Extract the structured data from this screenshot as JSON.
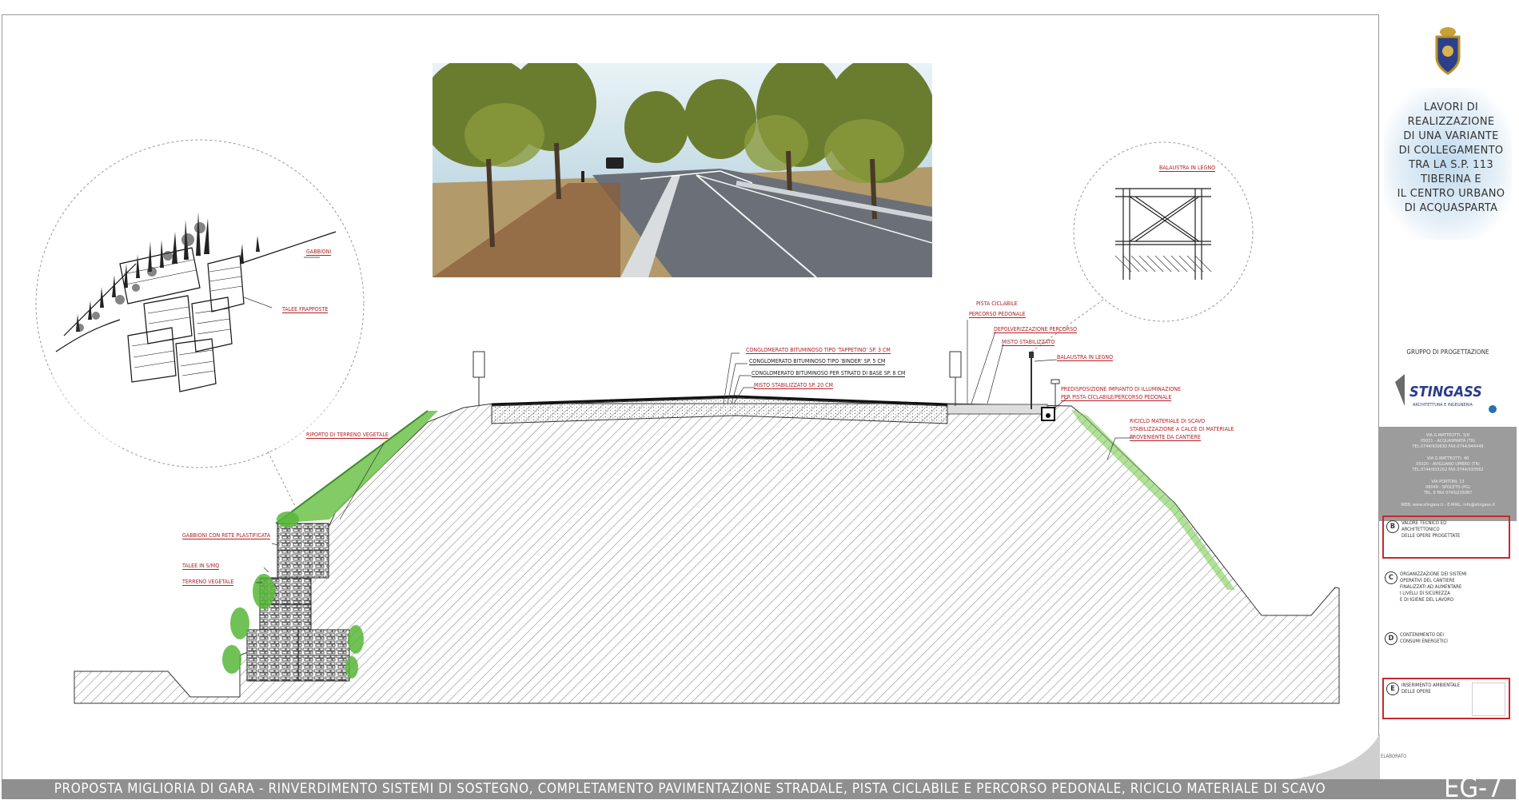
{
  "project_title": "LAVORI DI\nREALIZZAZIONE\nDI UNA VARIANTE\nDI COLLEGAMENTO\nTRA LA S.P. 113\nTIBERINA E\nIL CENTRO URBANO\nDI ACQUASPARTA",
  "gruppo_label": "GRUPPO DI PROGETTAZIONE",
  "firm": {
    "name": "STINGASS",
    "subtitle": "ARCHITETTURA E INGEGNERIA",
    "addresses": [
      "VIA G.MATTEOTTI, 3/D\n05021 - ACQUASPARTA (TR)\nTEL.0744/930630 FAX.0744/944449",
      "VIA G.MATTEOTTI, 48\n05020 - AVIGLIANO UMBRO (TR)\nTEL.0744/933202 FAX.0744/933562",
      "VIA PORTONI, 13\n06049 - SPOLETO (PG)\nTEL. E FAX 0743/235087",
      "WEB: www.stingass.it - E-MAIL: info@stingass.it"
    ]
  },
  "criteria": [
    {
      "letter": "B",
      "text": "VALORE TECNICO ED\nARCHITETTONICO\nDELLE OPERE PROGETTATE",
      "highlighted": true
    },
    {
      "letter": "C",
      "text": "ORGANIZZAZIONE DEI SISTEMI\nOPERATIVI DEL CANTIERE\nFINALIZZATI AD AUMENTARE\nI LIVELLI DI SICUREZZA\nE DI IGIENE DEL LAVORO",
      "highlighted": false
    },
    {
      "letter": "D",
      "text": "CONTENIMENTO DEI\nCONSUMI ENERGETICI",
      "highlighted": false
    },
    {
      "letter": "E",
      "text": "INSERIMENTO AMBIENTALE\nDELLE OPERE",
      "highlighted": true
    }
  ],
  "elaborato_label": "ELABORATO",
  "sheet_code": "EG-7",
  "footer_title": "PROPOSTA MIGLIORIA DI GARA - RINVERDIMENTO SISTEMI DI SOSTEGNO, COMPLETAMENTO PAVIMENTAZIONE STRADALE, PISTA CICLABILE E PERCORSO PEDONALE, RICICLO MATERIALE DI SCAVO",
  "labels": {
    "gabbioni": "GABBIONI",
    "talee_frapposte": "TALEE FRAPPOSTE",
    "riporto": "RIPORTO DI TERRENO VEGETALE",
    "gabbioni_rete": "GABBIONI CON RETE PLASTIFICATA",
    "talee_ms": "TALEE IN S/MQ",
    "terreno_vegetale": "TERRENO VEGETALE",
    "tappetino": "CONGLOMERATO BITUMINOSO TIPO 'TAPPETINO' SP. 3 CM",
    "binder": "CONGLOMERATO BITUMINOSO TIPO 'BINDER' SP. 5 CM",
    "base": "CONGLOMERATO BITUMINOSO PER STRATO DI BASE SP. 8 CM",
    "misto_20": "MISTO STABILIZZATO SP. 20 CM",
    "pista_ciclabile_1": "PISTA CICLABILE",
    "pista_ciclabile_2": "PERCORSO PEDONALE",
    "depolverizzazione": "DEPOLVERIZZAZIONE PERCORSO",
    "misto": "MISTO STABILIZZATO",
    "balaustra_legno": "BALAUSTRA IN LEGNO",
    "illuminazione_1": "PREDISPOSIZIONE IMPIANTO DI ILLUMINAZIONE",
    "illuminazione_2": "PER PISTA CICLABILE/PERCORSO PEDONALE",
    "riciclo_1": "RICICLO MATERIALE DI SCAVO",
    "riciclo_2": "STABILIZZAZIONE A CALCE DI MATERIALE",
    "riciclo_3": "PROVENIENTE DA CANTIERE",
    "balaustra_detail": "BALAUSTRA IN LEGNO"
  }
}
